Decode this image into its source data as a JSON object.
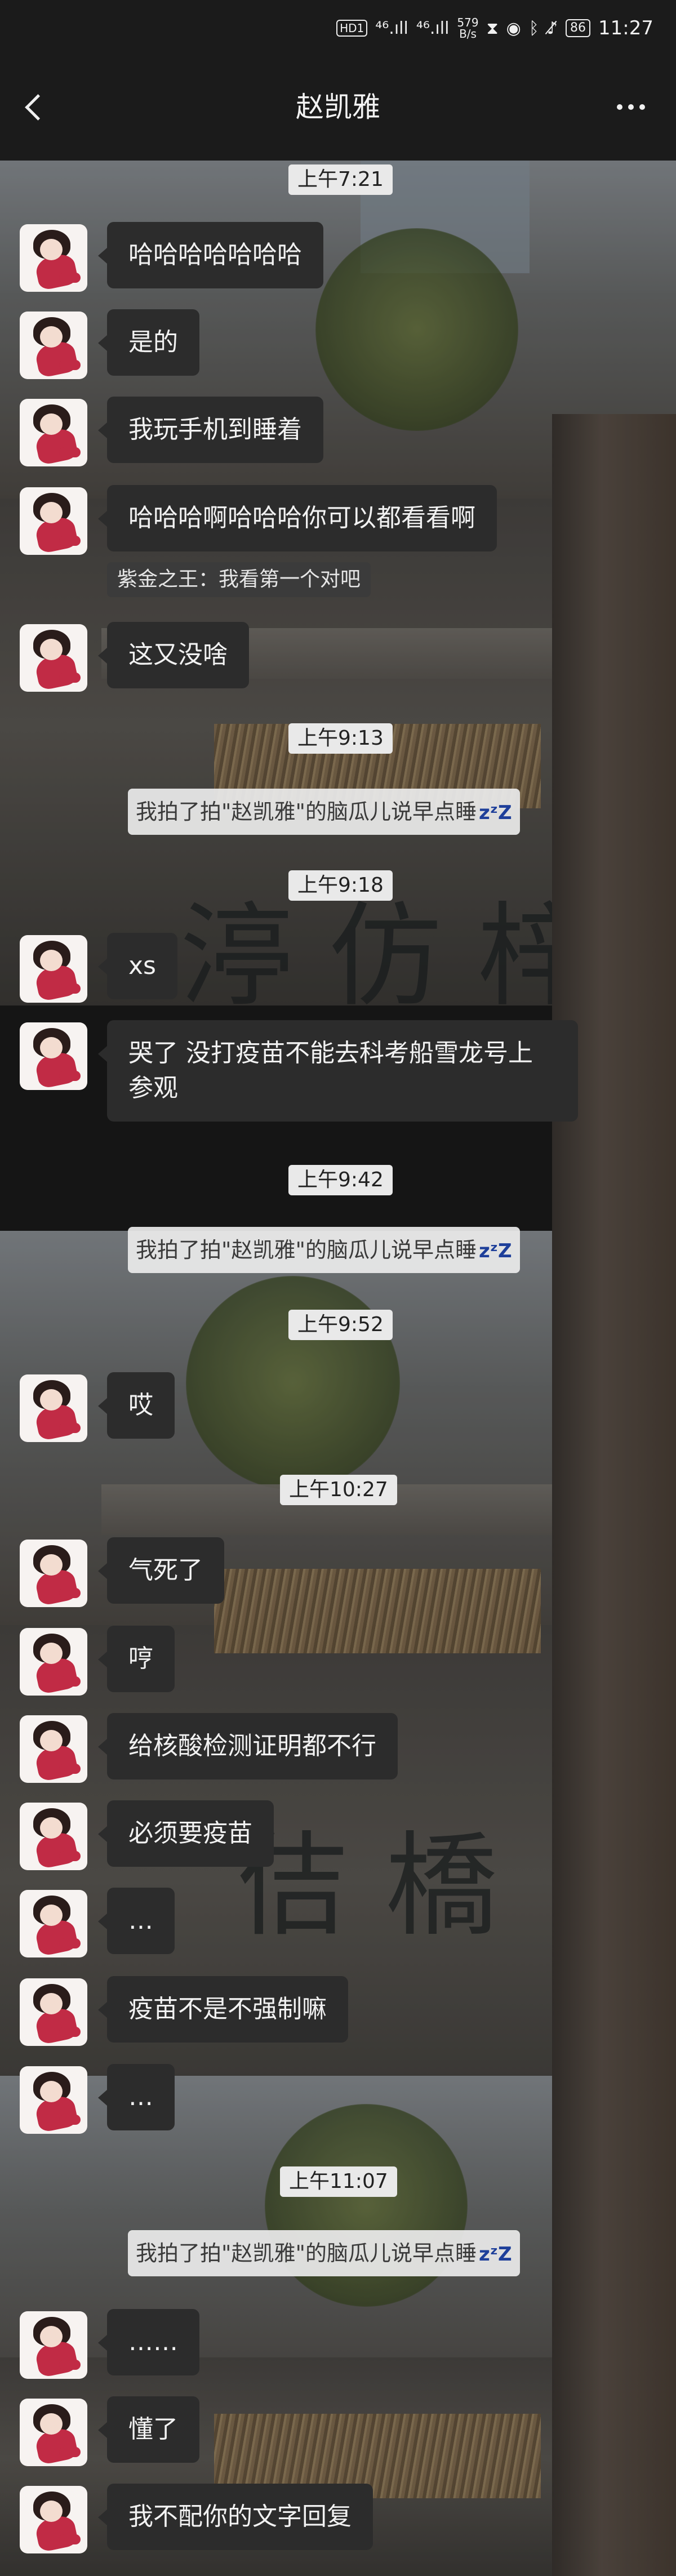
{
  "status_bar": {
    "hd_badge": "HD1",
    "signal_1": "⁴⁶.ıll",
    "signal_2": "⁴⁶.ıll",
    "net_speed": "579",
    "net_unit": "B/s",
    "battery": "86",
    "time": "11:27"
  },
  "header": {
    "title": "赵凯雅"
  },
  "chat": [
    {
      "type": "time",
      "text": "上午7:21"
    },
    {
      "type": "msg",
      "text": "哈哈哈哈哈哈哈"
    },
    {
      "type": "msg",
      "text": "是的"
    },
    {
      "type": "msg",
      "text": "我玩手机到睡着"
    },
    {
      "type": "msg",
      "text": "哈哈哈啊哈哈哈你可以都看看啊"
    },
    {
      "type": "quote",
      "text": "紫金之王：我看第一个对吧"
    },
    {
      "type": "msg",
      "text": "这又没啥"
    },
    {
      "type": "time",
      "text": "上午9:13"
    },
    {
      "type": "system",
      "text": "我拍了拍\"赵凯雅\"的脑瓜儿说早点睡",
      "emoji": "zᶻZ"
    },
    {
      "type": "time",
      "text": "上午9:18"
    },
    {
      "type": "msg",
      "text": "xs"
    },
    {
      "type": "msg",
      "text": "哭了 没打疫苗不能去科考船雪龙号上参观"
    },
    {
      "type": "time",
      "text": "上午9:42"
    },
    {
      "type": "system",
      "text": "我拍了拍\"赵凯雅\"的脑瓜儿说早点睡",
      "emoji": "zᶻZ"
    },
    {
      "type": "time",
      "text": "上午9:52"
    },
    {
      "type": "msg",
      "text": "哎"
    },
    {
      "type": "time",
      "text": "上午10:27"
    },
    {
      "type": "msg",
      "text": "气死了"
    },
    {
      "type": "msg",
      "text": "哼"
    },
    {
      "type": "msg",
      "text": "给核酸检测证明都不行"
    },
    {
      "type": "msg",
      "text": "必须要疫苗"
    },
    {
      "type": "msg",
      "text": "…"
    },
    {
      "type": "msg",
      "text": "疫苗不是不强制嘛"
    },
    {
      "type": "msg",
      "text": "…"
    },
    {
      "type": "time",
      "text": "上午11:07"
    },
    {
      "type": "system",
      "text": "我拍了拍\"赵凯雅\"的脑瓜儿说早点睡",
      "emoji": "zᶻZ"
    },
    {
      "type": "msg",
      "text": "……"
    },
    {
      "type": "msg",
      "text": "懂了"
    },
    {
      "type": "msg",
      "text": "我不配你的文字回复"
    }
  ]
}
